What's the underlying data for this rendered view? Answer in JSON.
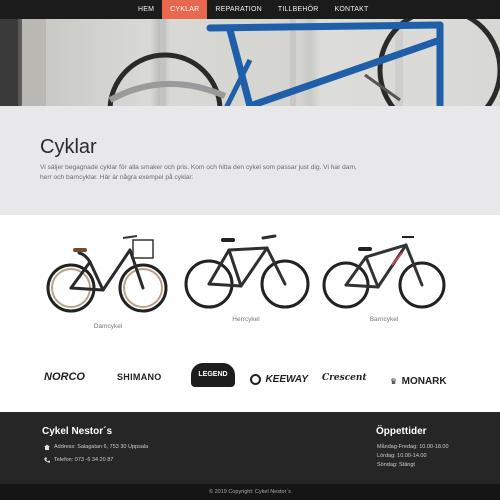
{
  "nav": {
    "items": [
      {
        "label": "HEM",
        "active": false
      },
      {
        "label": "CYKLAR",
        "active": true
      },
      {
        "label": "REPARATION",
        "active": false
      },
      {
        "label": "TILLBEHÖR",
        "active": false
      },
      {
        "label": "KONTAKT",
        "active": false
      }
    ]
  },
  "intro": {
    "title": "Cyklar",
    "text": "Vi säljer begagnade cyklar för alla smaker och pris. Kom och hitta den cykel som passar just dig. Vi har dam, herr och barncyklar. Här är några exempel på cyklar:"
  },
  "bikes": [
    {
      "caption": "Damcykel",
      "icon": "women-bike-with-basket"
    },
    {
      "caption": "Herrcykel",
      "icon": "men-bike"
    },
    {
      "caption": "Barncykel",
      "icon": "kids-mountain-bike"
    }
  ],
  "brands": [
    "NORCO",
    "SHIMANO",
    "LEGEND",
    "KEEWAY",
    "Crescent",
    "MONARK"
  ],
  "footer": {
    "company": "Cykel Nestor´s",
    "address": "Address: Salagatan 6, 753 30 Uppsala",
    "phone": "Telefon: 073 -6 34 20 87",
    "hours_title": "Öppettider",
    "hours": [
      "Måndag-Fredag: 10.00-18.00",
      "Lördag: 10.00-14.00",
      "Söndag: Stängt"
    ],
    "copyright": "© 2019 Copyright: Cykel Nestor´s"
  },
  "colors": {
    "accent": "#e8684f",
    "nav_bg": "#1b1b1b",
    "footer_bg": "#262626",
    "bike_blue": "#1f5ea8"
  }
}
